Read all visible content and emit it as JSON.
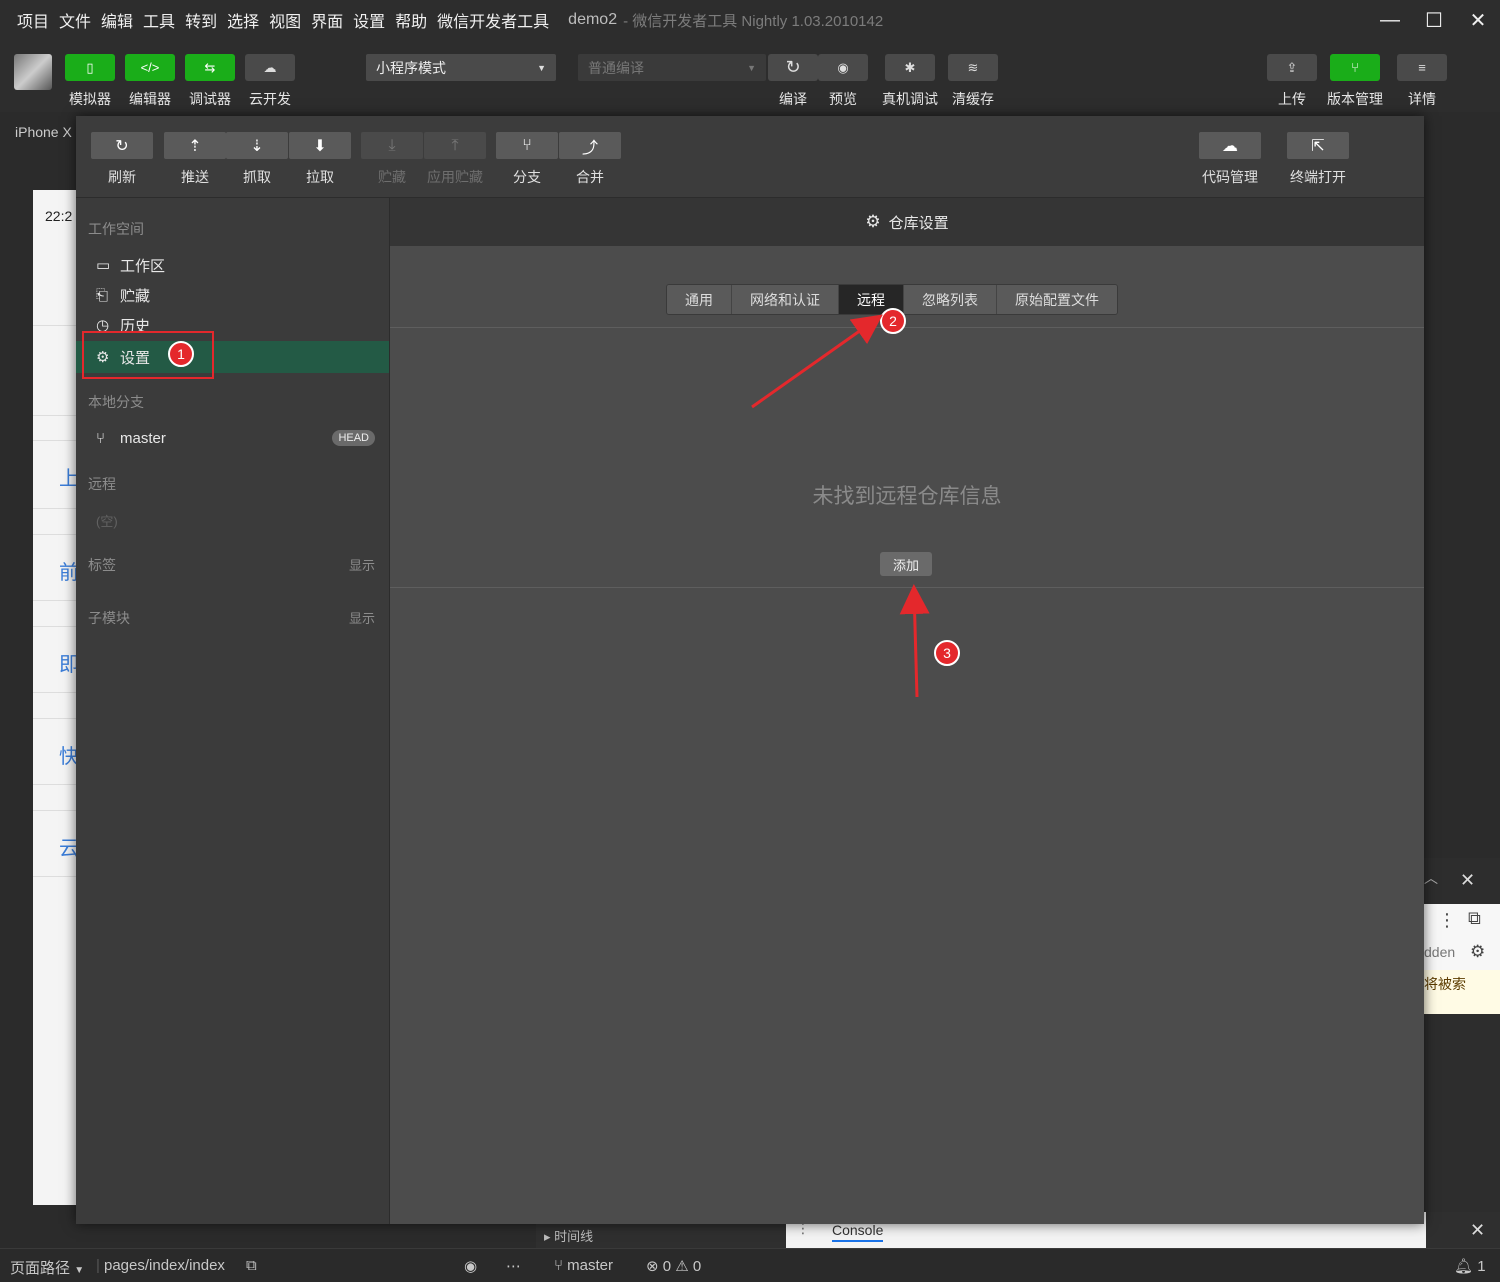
{
  "menubar": {
    "items": [
      "项目",
      "文件",
      "编辑",
      "工具",
      "转到",
      "选择",
      "视图",
      "界面",
      "设置",
      "帮助",
      "微信开发者工具"
    ],
    "project": "demo2",
    "app_title": "- 微信开发者工具 Nightly 1.03.2010142",
    "minimize": "—",
    "maximize": "☐",
    "close": "✕"
  },
  "toolbar": {
    "left": [
      {
        "label": "模拟器",
        "icon": "phone-icon",
        "glyph": "▯"
      },
      {
        "label": "编辑器",
        "icon": "code-icon",
        "glyph": "</>"
      },
      {
        "label": "调试器",
        "icon": "debugger-icon",
        "glyph": "⇆"
      },
      {
        "label": "云开发",
        "icon": "cloud-icon",
        "glyph": "☁"
      }
    ],
    "mode": "小程序模式",
    "compile_mode": "普通编译",
    "middle": [
      {
        "label": "编译",
        "icon": "refresh-icon",
        "glyph": "↻"
      },
      {
        "label": "预览",
        "icon": "eye-icon",
        "glyph": "◉"
      },
      {
        "label": "真机调试",
        "icon": "bug-icon",
        "glyph": "✱"
      },
      {
        "label": "清缓存",
        "icon": "layers-icon",
        "glyph": "≋"
      }
    ],
    "right": [
      {
        "label": "上传",
        "icon": "upload-icon",
        "glyph": "⇪"
      },
      {
        "label": "版本管理",
        "icon": "branch-icon",
        "glyph": "⑂"
      },
      {
        "label": "详情",
        "icon": "menu-icon",
        "glyph": "≡"
      }
    ]
  },
  "simulator": {
    "device": "iPhone X",
    "time": "22:2",
    "chars": [
      "上",
      "前",
      "即",
      "快",
      "云"
    ]
  },
  "git_toolbar": {
    "left": [
      {
        "label": "刷新",
        "glyph": "↻",
        "enabled": true
      },
      {
        "label": "推送",
        "glyph": "⇡",
        "enabled": true
      },
      {
        "label": "抓取",
        "glyph": "⇣",
        "enabled": true
      },
      {
        "label": "拉取",
        "glyph": "⬇",
        "enabled": true
      },
      {
        "label": "贮藏",
        "glyph": "⤓",
        "enabled": false
      },
      {
        "label": "应用贮藏",
        "glyph": "⤒",
        "enabled": false
      },
      {
        "label": "分支",
        "glyph": "⑂",
        "enabled": true
      },
      {
        "label": "合并",
        "glyph": "⤴",
        "enabled": true
      }
    ],
    "right": [
      {
        "label": "代码管理",
        "glyph": "☁"
      },
      {
        "label": "终端打开",
        "glyph": "⇱"
      }
    ]
  },
  "git_sidebar": {
    "workspace_title": "工作空间",
    "items": [
      {
        "label": "工作区",
        "glyph": "▭"
      },
      {
        "label": "贮藏",
        "glyph": "⎗"
      },
      {
        "label": "历史",
        "glyph": "◷"
      },
      {
        "label": "设置",
        "glyph": "⚙"
      }
    ],
    "local_branches_title": "本地分支",
    "branch": "master",
    "head_badge": "HEAD",
    "remote_title": "远程",
    "remote_empty": "(空)",
    "tags_title": "标签",
    "tags_toggle": "显示",
    "submodules_title": "子模块",
    "submodules_toggle": "显示"
  },
  "git_main": {
    "header": "仓库设置",
    "tabs": [
      "通用",
      "网络和认证",
      "远程",
      "忽略列表",
      "原始配置文件"
    ],
    "selected_tab": "远程",
    "empty_message": "未找到远程仓库信息",
    "add_button": "添加"
  },
  "annotations": [
    "1",
    "2",
    "3"
  ],
  "background": {
    "right_text1": "dden",
    "right_text2": "将被索",
    "timeline": "时间线",
    "console_tab": "Console"
  },
  "statusbar": {
    "page_path_label": "页面路径",
    "page_path": "pages/index/index",
    "branch": "master",
    "errors": "0",
    "warnings": "0",
    "notifications": "1"
  },
  "colors": {
    "accent_green": "#1aad19",
    "active_item": "#235a45",
    "annotation_red": "#e4282c"
  }
}
